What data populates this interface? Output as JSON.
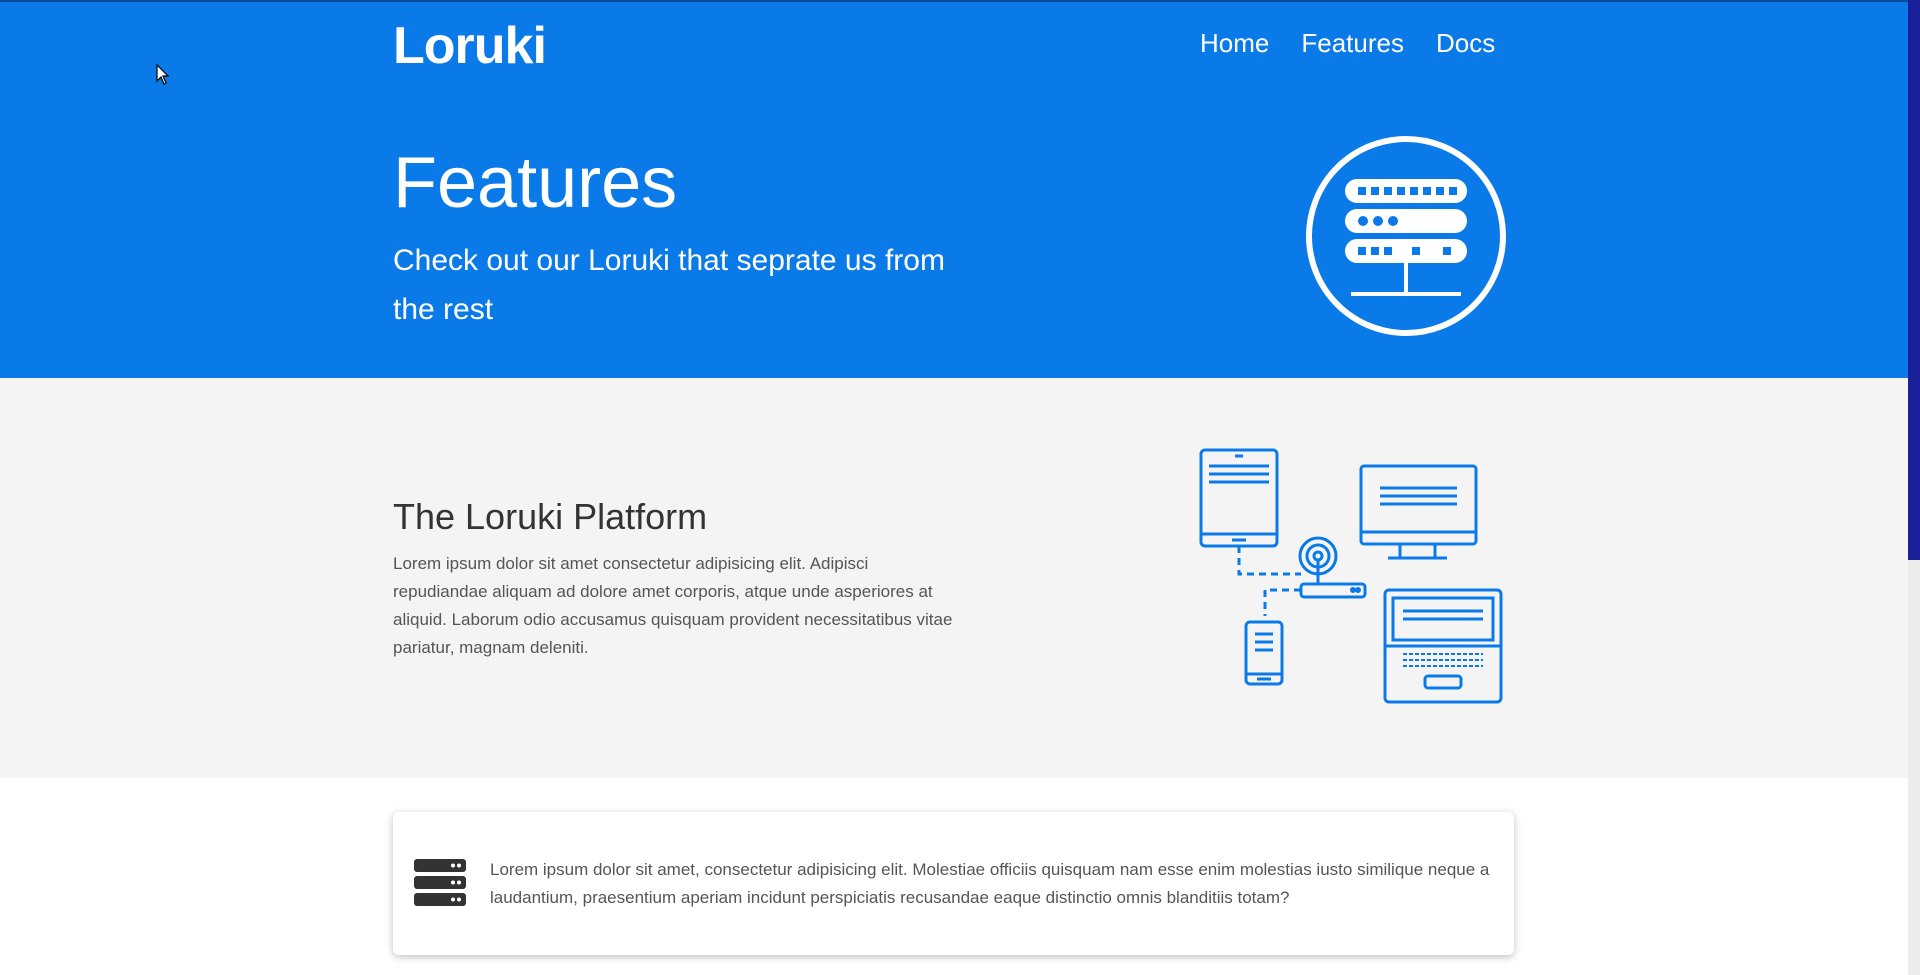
{
  "brand": "Loruki",
  "nav": {
    "home": "Home",
    "features": "Features",
    "docs": "Docs"
  },
  "hero": {
    "title": "Features",
    "subtitle": "Check out our Loruki that seprate us from the rest",
    "icon": "server-circle-icon"
  },
  "platform": {
    "title": "The Loruki Platform",
    "text": "Lorem ipsum dolor sit amet consectetur adipisicing elit. Adipisci repudiandae aliquam ad dolore amet corporis, atque unde asperiores at aliquid. Laborum odio accusamus quisquam provident necessitatibus vitae pariatur, magnam deleniti.",
    "icon": "connected-devices-icon"
  },
  "card": {
    "icon": "server-stack-icon",
    "text": "Lorem ipsum dolor sit amet, consectetur adipisicing elit. Molestiae officiis quisquam nam esse enim molestias iusto similique neque a laudantium, praesentium aperiam incidunt perspiciatis recusandae eaque distinctio omnis blanditiis totam?"
  },
  "colors": {
    "primary": "#0a7ae9",
    "light_bg": "#f4f4f4",
    "dark_icon": "#333333",
    "scrollbar_thumb": "#1a1f9a"
  }
}
